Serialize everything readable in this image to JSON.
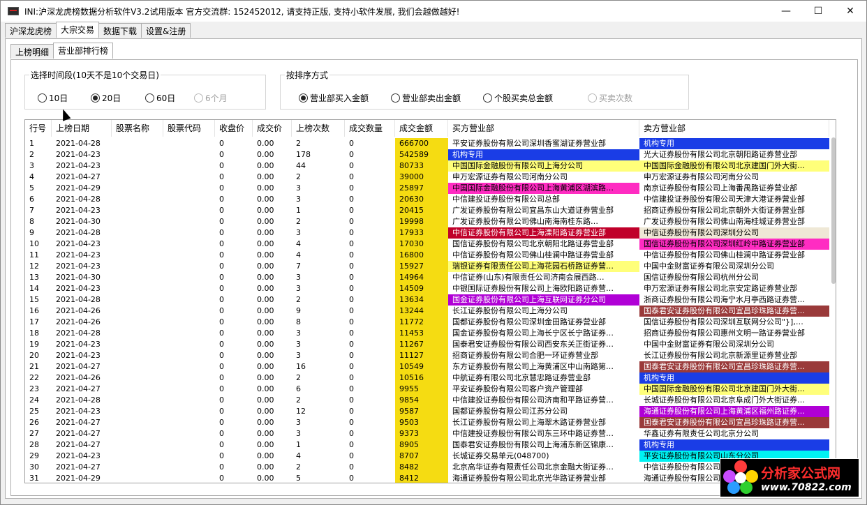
{
  "window": {
    "title": "INI:沪深龙虎榜数据分析软件V3.2试用版本  官方交流群: 152452012,  请支持正版,  支持小软件发展,  我们会越做越好!",
    "minimize": "—",
    "maximize": "☐",
    "close": "✕"
  },
  "main_tabs": [
    {
      "label": "沪深龙虎榜",
      "active": false
    },
    {
      "label": "大宗交易",
      "active": true
    },
    {
      "label": "数据下载",
      "active": false
    },
    {
      "label": "设置&注册",
      "active": false
    }
  ],
  "sub_tabs": [
    {
      "label": "上榜明细",
      "active": false
    },
    {
      "label": "营业部排行榜",
      "active": true
    }
  ],
  "period_group": {
    "title": "选择时间段(10天不是10个交易日)",
    "options": [
      {
        "label": "10日",
        "checked": false,
        "disabled": false
      },
      {
        "label": "20日",
        "checked": true,
        "disabled": false
      },
      {
        "label": "60日",
        "checked": false,
        "disabled": false
      },
      {
        "label": "6个月",
        "checked": false,
        "disabled": true
      }
    ]
  },
  "sort_group": {
    "title": "按排序方式",
    "options": [
      {
        "label": "营业部买入金额",
        "checked": true,
        "disabled": false
      },
      {
        "label": "营业部卖出金额",
        "checked": false,
        "disabled": false
      },
      {
        "label": "个股买卖总金额",
        "checked": false,
        "disabled": false
      },
      {
        "label": "买卖次数",
        "checked": false,
        "disabled": true
      }
    ]
  },
  "table": {
    "columns": [
      "行号",
      "上榜日期",
      "股票名称",
      "股票代码",
      "收盘价",
      "成交价",
      "上榜次数",
      "成交数量",
      "成交金额",
      "买方营业部",
      "卖方营业部"
    ],
    "rows": [
      [
        "1",
        "2021-04-28",
        "",
        "",
        "0",
        "0.00",
        "2",
        "0",
        "666700",
        "平安证券股份有限公司深圳香蜜湖证券营业部",
        "机构专用",
        "",
        "blue"
      ],
      [
        "2",
        "2021-04-23",
        "",
        "",
        "0",
        "0.00",
        "178",
        "0",
        "542589",
        "机构专用",
        "光大证券股份有限公司北京朝阳路证券营业部",
        "blue",
        ""
      ],
      [
        "3",
        "2021-04-23",
        "",
        "",
        "0",
        "0.00",
        "44",
        "0",
        "80733",
        "中国国际金融股份有限公司上海分公司",
        "中国国际金融股份有限公司北京建国门外大街…",
        "yellow",
        "yellow"
      ],
      [
        "4",
        "2021-04-27",
        "",
        "",
        "0",
        "0.00",
        "2",
        "0",
        "39000",
        "申万宏源证券有限公司河南分公司",
        "申万宏源证券有限公司河南分公司",
        "",
        ""
      ],
      [
        "5",
        "2021-04-29",
        "",
        "",
        "0",
        "0.00",
        "3",
        "0",
        "25897",
        "中国国际金融股份有限公司上海黄浦区湖滨路…",
        "南京证券股份有限公司上海番禺路证券营业部",
        "magenta",
        ""
      ],
      [
        "6",
        "2021-04-28",
        "",
        "",
        "0",
        "0.00",
        "3",
        "0",
        "20630",
        "中信建投证券股份有限公司总部",
        "中信建投证券股份有限公司天津大港证券营业部",
        "",
        ""
      ],
      [
        "7",
        "2021-04-23",
        "",
        "",
        "0",
        "0.00",
        "1",
        "0",
        "20415",
        "广发证券股份有限公司宜昌东山大道证券营业部",
        "招商证券股份有限公司北京朝外大街证券营业部",
        "",
        ""
      ],
      [
        "8",
        "2021-04-30",
        "",
        "",
        "0",
        "0.00",
        "2",
        "0",
        "19998",
        "广发证券股份有限公司佛山南海南桂东路…",
        "广发证券股份有限公司佛山南海桂城证券营业部",
        "",
        ""
      ],
      [
        "9",
        "2021-04-28",
        "",
        "",
        "0",
        "0.00",
        "3",
        "0",
        "17933",
        "中信证券股份有限公司上海溧阳路证券营业部",
        "中信证券股份有限公司深圳分公司",
        "crimson",
        "beige"
      ],
      [
        "10",
        "2021-04-23",
        "",
        "",
        "0",
        "0.00",
        "4",
        "0",
        "17030",
        "国信证券股份有限公司北京朝阳北路证券营业部",
        "国信证券股份有限公司深圳红岭中路证券营业部",
        "",
        "magenta"
      ],
      [
        "11",
        "2021-04-23",
        "",
        "",
        "0",
        "0.00",
        "4",
        "0",
        "16800",
        "中信证券股份有限公司佛山桂澜中路证券营业部",
        "中信证券股份有限公司佛山桂澜中路证券营业部",
        "",
        ""
      ],
      [
        "12",
        "2021-04-23",
        "",
        "",
        "0",
        "0.00",
        "7",
        "0",
        "15927",
        "瑞银证券有限责任公司上海花园石桥路证券营…",
        "中国中金财富证券有限公司深圳分公司",
        "yellow",
        ""
      ],
      [
        "13",
        "2021-04-30",
        "",
        "",
        "0",
        "0.00",
        "3",
        "0",
        "14964",
        "中信证券(山东)有限责任公司济南会展西路…",
        "国信证券股份有限公司杭州分公司",
        "",
        ""
      ],
      [
        "14",
        "2021-04-23",
        "",
        "",
        "0",
        "0.00",
        "3",
        "0",
        "14509",
        "中银国际证券股份有限公司上海欧阳路证券营…",
        "申万宏源证券有限公司北京安定路证券营业部",
        "",
        ""
      ],
      [
        "15",
        "2021-04-28",
        "",
        "",
        "0",
        "0.00",
        "2",
        "0",
        "13634",
        "国金证券股份有限公司上海互联网证券分公司",
        "浙商证券股份有限公司海宁水月亭西路证券营…",
        "purple",
        ""
      ],
      [
        "16",
        "2021-04-26",
        "",
        "",
        "0",
        "0.00",
        "9",
        "0",
        "13244",
        "长江证券股份有限公司上海分公司",
        "国泰君安证券股份有限公司宜昌珍珠路证券营…",
        "",
        "brown"
      ],
      [
        "17",
        "2021-04-26",
        "",
        "",
        "0",
        "0.00",
        "8",
        "0",
        "11772",
        "国都证券股份有限公司深圳金田路证券营业部",
        "国信证券股份有限公司深圳互联网分公司\"}],…",
        "",
        ""
      ],
      [
        "18",
        "2021-04-28",
        "",
        "",
        "0",
        "0.00",
        "3",
        "0",
        "11453",
        "国金证券股份有限公司上海长宁区长宁路证券…",
        "招商证券股份有限公司惠州文明一路证券营业部",
        "",
        ""
      ],
      [
        "19",
        "2021-04-23",
        "",
        "",
        "0",
        "0.00",
        "3",
        "0",
        "11267",
        "国泰君安证券股份有限公司西安东关正街证券…",
        "中国中金财富证券有限公司深圳分公司",
        "",
        ""
      ],
      [
        "20",
        "2021-04-23",
        "",
        "",
        "0",
        "0.00",
        "3",
        "0",
        "11127",
        "招商证券股份有限公司合肥一环证券营业部",
        "长江证券股份有限公司北京新源里证券营业部",
        "",
        ""
      ],
      [
        "21",
        "2021-04-27",
        "",
        "",
        "0",
        "0.00",
        "16",
        "0",
        "10549",
        "东方证券股份有限公司上海黄浦区中山南路第…",
        "国泰君安证券股份有限公司宜昌珍珠路证券营…",
        "",
        "brown"
      ],
      [
        "22",
        "2021-04-26",
        "",
        "",
        "0",
        "0.00",
        "2",
        "0",
        "10516",
        "中航证券有限公司北京慧忠路证券营业部",
        "机构专用",
        "",
        "blue"
      ],
      [
        "23",
        "2021-04-27",
        "",
        "",
        "0",
        "0.00",
        "6",
        "0",
        "9955",
        "平安证券股份有限公司客户资产管理部",
        "中国国际金融股份有限公司北京建国门外大街…",
        "",
        "yellow"
      ],
      [
        "24",
        "2021-04-28",
        "",
        "",
        "0",
        "0.00",
        "2",
        "0",
        "9854",
        "中信建投证券股份有限公司济南和平路证券营…",
        "长城证券股份有限公司北京阜成门外大街证券…",
        "",
        ""
      ],
      [
        "25",
        "2021-04-23",
        "",
        "",
        "0",
        "0.00",
        "12",
        "0",
        "9587",
        "国都证券股份有限公司江苏分公司",
        "海通证券股份有限公司上海黄浦区福州路证券…",
        "",
        "purple"
      ],
      [
        "26",
        "2021-04-27",
        "",
        "",
        "0",
        "0.00",
        "3",
        "0",
        "9503",
        "长江证券股份有限公司上海翠木路证券营业部",
        "国泰君安证券股份有限公司宜昌珍珠路证券营…",
        "",
        "brown"
      ],
      [
        "27",
        "2021-04-27",
        "",
        "",
        "0",
        "0.00",
        "3",
        "0",
        "9373",
        "中信建投证券股份有限公司东三环中路证券营…",
        "华鑫证券有限责任公司北京分公司",
        "",
        ""
      ],
      [
        "28",
        "2021-04-27",
        "",
        "",
        "0",
        "0.00",
        "1",
        "0",
        "8905",
        "国泰君安证券股份有限公司上海浦东新区锦康…",
        "机构专用",
        "",
        "blue"
      ],
      [
        "29",
        "2021-04-23",
        "",
        "",
        "0",
        "0.00",
        "4",
        "0",
        "8707",
        "长城证券交易单元(048700)",
        "平安证券股份有限公司山东分公司",
        "",
        "cyan"
      ],
      [
        "30",
        "2021-04-27",
        "",
        "",
        "0",
        "0.00",
        "2",
        "0",
        "8482",
        "北京高华证券有限责任公司北京金融大街证券…",
        "中信证券股份有限公司北京总部证券营业部",
        "",
        ""
      ],
      [
        "31",
        "2021-04-29",
        "",
        "",
        "0",
        "0.00",
        "5",
        "0",
        "8412",
        "海通证券股份有限公司北京光华路证券营业部",
        "海通证券股份有限公司北京光华路证券营业部",
        "",
        ""
      ]
    ]
  },
  "watermark": {
    "name": "分析家公式网",
    "url": "www.70822.com"
  }
}
